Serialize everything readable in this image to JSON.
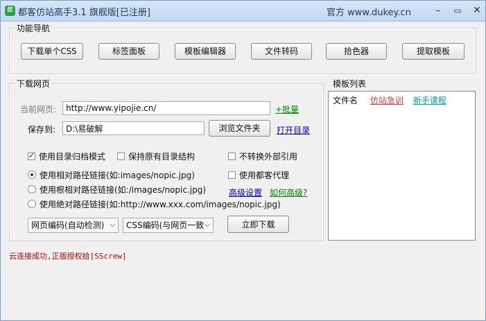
{
  "window": {
    "title": "都客仿站高手3.1 旗舰版[已注册]",
    "site": "官方 www.dukey.cn",
    "minimize": "‒",
    "maximize": "▭",
    "close": "✕",
    "icon_glyph": "都"
  },
  "nav": {
    "title": "功能导航",
    "buttons": [
      "下载单个CSS",
      "标签面板",
      "模板编辑器",
      "文件转码",
      "拾色器",
      "提取模板"
    ]
  },
  "download": {
    "title": "下载网页",
    "url_label": "当前网页:",
    "url_value": "http://www.yipojie.cn/",
    "batch_link": "+批量",
    "save_label": "保存到:",
    "save_value": "D:\\易破解",
    "browse_button": "浏览文件夹",
    "open_dir_link": "打开目录",
    "checkboxes": {
      "dir_archive": {
        "label": "使用目录归档模式",
        "checked": true
      },
      "keep_structure": {
        "label": "保持原有目录结构",
        "checked": false
      },
      "no_convert_external": {
        "label": "不转换外部引用",
        "checked": false
      },
      "use_proxy": {
        "label": "使用都客代理",
        "checked": false
      }
    },
    "radios": [
      {
        "label": "使用相对路径链接(如:images/nopic.jpg)",
        "checked": true
      },
      {
        "label": "使用根相对路径链接(如:/images/nopic.jpg)",
        "checked": false
      },
      {
        "label": "使用绝对路径链接(如:http://www.xxx.com/images/nopic.jpg)",
        "checked": false
      }
    ],
    "advanced_link": "高级设置",
    "how_advanced_link": "如何高级?",
    "page_encoding": "网页编码(自动检测)",
    "css_encoding": "CSS编码(与网页一致",
    "download_now": "立即下载"
  },
  "templates": {
    "title": "模板列表",
    "column": "文件名",
    "link1": "仿站急训",
    "link2": "新手课程"
  },
  "status": "云连接成功,正版授权给[SScrew]"
}
